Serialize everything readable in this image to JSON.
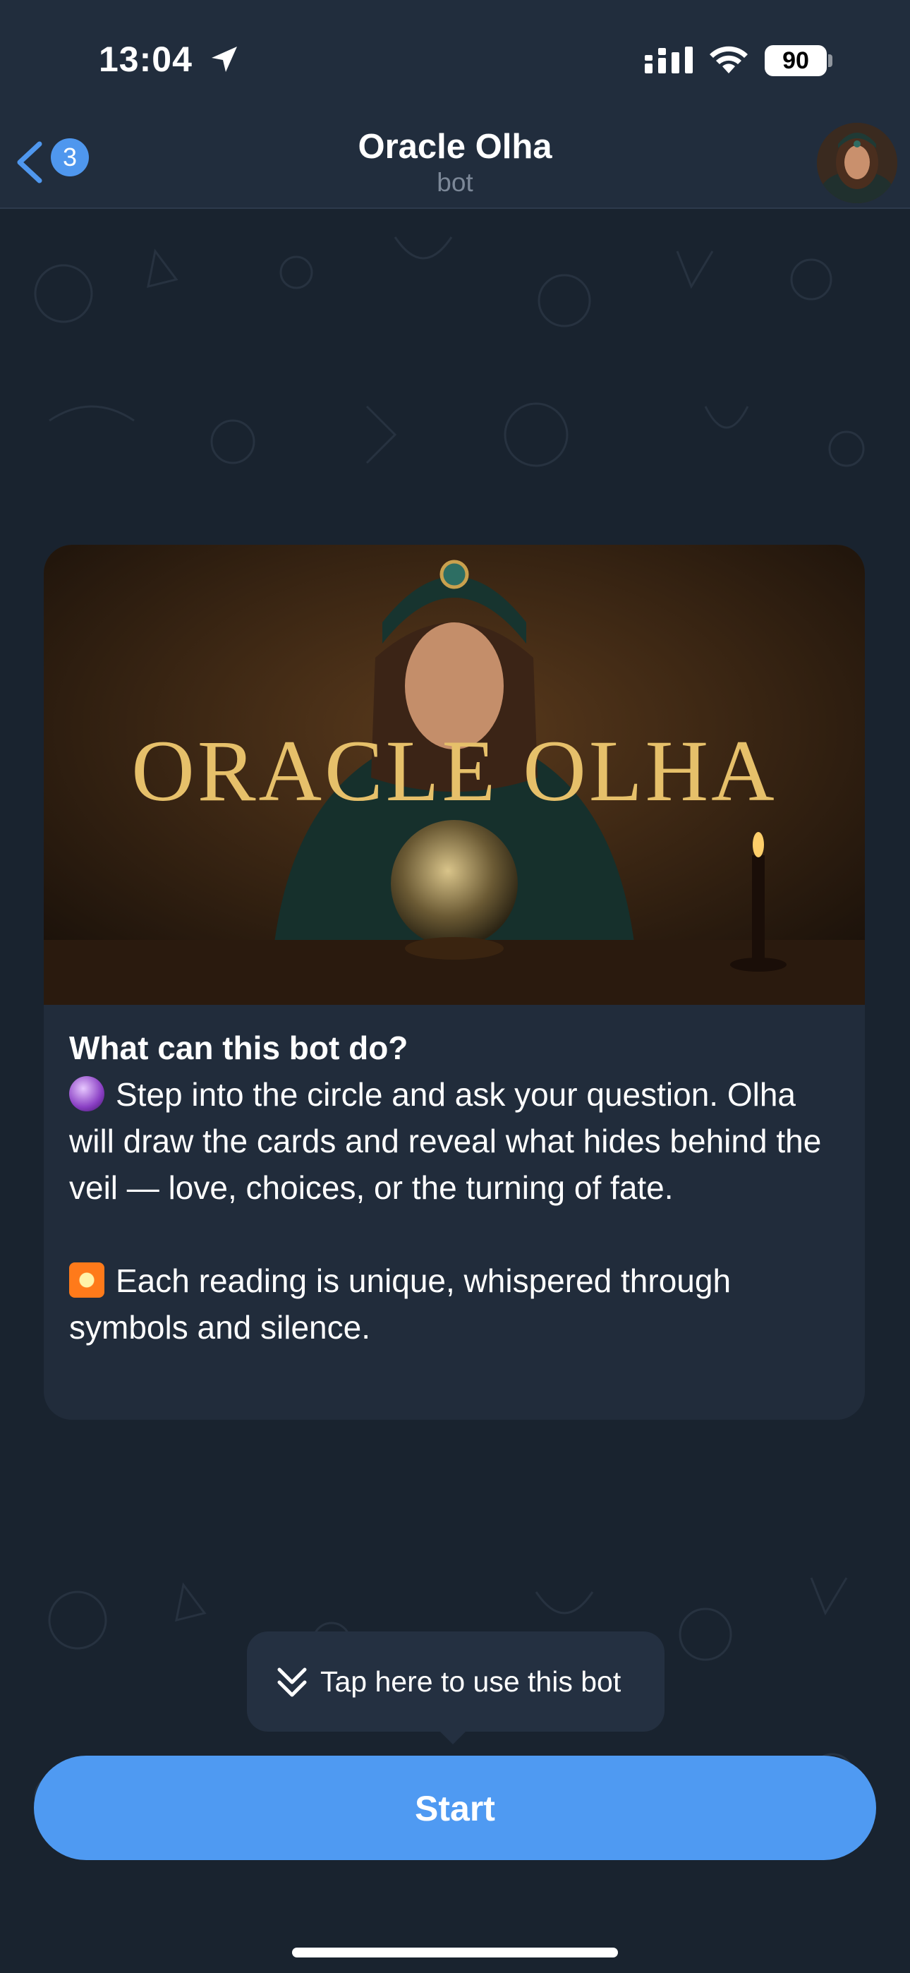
{
  "status_bar": {
    "time": "13:04",
    "battery": "90",
    "icons": [
      "location-arrow-icon",
      "cellular-signal-icon",
      "wifi-icon",
      "battery-icon"
    ]
  },
  "header": {
    "back_badge": "3",
    "title": "Oracle Olha",
    "subtitle": "bot",
    "icons": [
      "chevron-left-icon",
      "avatar"
    ]
  },
  "intro_card": {
    "banner_title": "ORACLE OLHA",
    "heading": "What can this bot do?",
    "paragraph1": "Step into the circle and ask your question. Olha will draw the cards and reveal what hides behind the veil — love, choices, or the turning of fate.",
    "paragraph2": "Each reading is unique, whispered through symbols and silence.",
    "icons": [
      "crystal-ball-emoji-icon",
      "sparkle-star-emoji-icon"
    ]
  },
  "tooltip": {
    "text": "Tap here to use this bot",
    "icon": "double-chevron-down-icon"
  },
  "start_button": {
    "label": "Start"
  },
  "colors": {
    "accent": "#4f9af2",
    "background": "#19232f",
    "header": "#212d3d",
    "card": "#212c3b"
  }
}
